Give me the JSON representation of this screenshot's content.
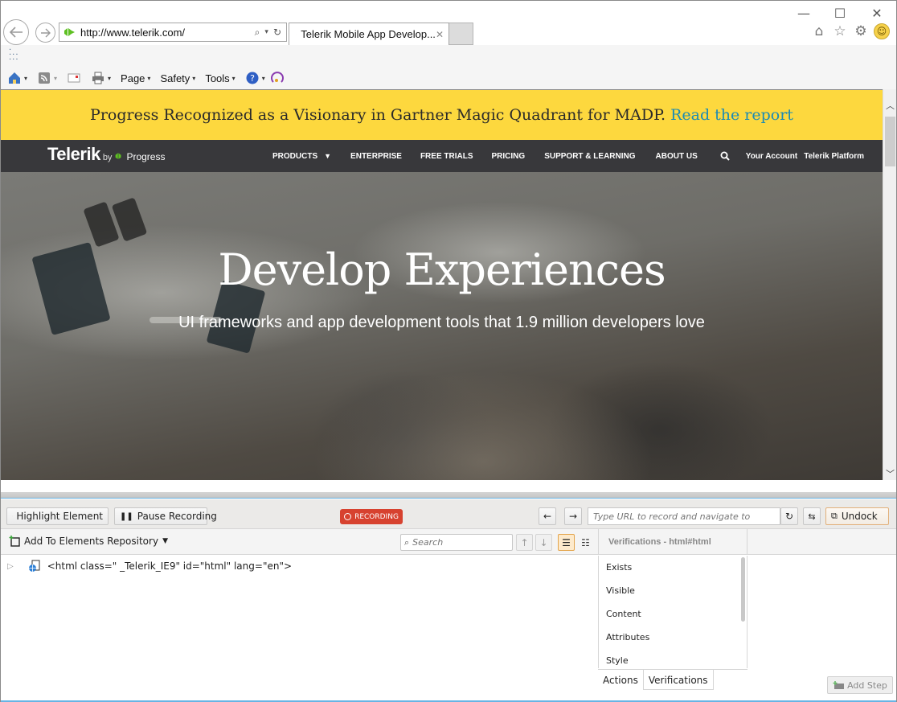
{
  "browser": {
    "window_controls": {
      "minimize": "—",
      "maximize": "☐",
      "close": "✕"
    },
    "address": {
      "url": "http://www.telerik.com/",
      "search_icon": "⌕",
      "dropdown_icon": "▾",
      "refresh_icon": "↻"
    },
    "tab": {
      "title": "Telerik Mobile App Develop...",
      "close_icon": "✕"
    },
    "right_icons": {
      "home": "⌂",
      "favorites": "☆",
      "settings": "⚙",
      "feedback": "☺"
    },
    "command_bar": {
      "items": [
        {
          "label": "Page"
        },
        {
          "label": "Safety"
        },
        {
          "label": "Tools"
        }
      ],
      "dropdown_glyph": "▾"
    }
  },
  "site": {
    "banner": {
      "text": "Progress Recognized as a Visionary in Gartner Magic Quadrant for MADP.",
      "link": "Read the report",
      "link_color": "#1b8bb5",
      "bg_color": "#fdd83e"
    },
    "brand": {
      "name": "Telerik",
      "by": "by",
      "parent": "Progress"
    },
    "nav": [
      "PRODUCTS",
      "ENTERPRISE",
      "FREE TRIALS",
      "PRICING",
      "SUPPORT & LEARNING",
      "ABOUT US"
    ],
    "nav_right": {
      "account": "Your Account",
      "platform": "Telerik Platform"
    },
    "hero": {
      "title": "Develop Experiences",
      "subtitle": "UI frameworks and app development tools that 1.9 million developers love"
    }
  },
  "recorder": {
    "highlight_label": "Highlight Element",
    "pause_label": "Pause Recording",
    "status_badge": "RECORDING",
    "status_color": "#d7422f",
    "url_placeholder": "Type URL to record and navigate to",
    "undock_label": "Undock",
    "add_repo_label": "Add To Elements Repository",
    "search_placeholder": "Search",
    "verifications_header": "Verifications - html#html",
    "tree_node": "<html class=\" _Telerik_IE9\" id=\"html\" lang=\"en\">",
    "verification_items": [
      "Exists",
      "Visible",
      "Content",
      "Attributes",
      "Style"
    ],
    "bottom_tabs": [
      "Actions",
      "Verifications"
    ],
    "add_step_label": "Add Step"
  }
}
